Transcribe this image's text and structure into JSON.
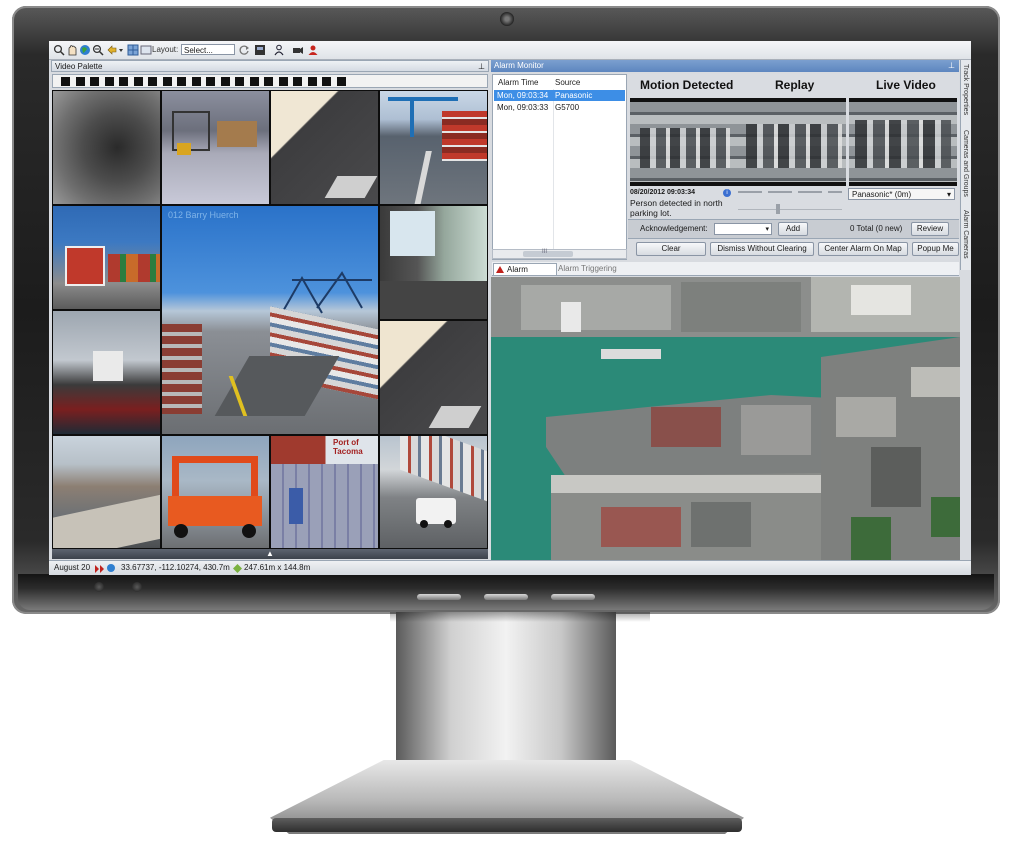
{
  "toolbar": {
    "layout_label": "Layout:",
    "layout_value": "Select...",
    "icons": [
      "zoom-icon",
      "pan-icon",
      "globe-icon",
      "zoom-out-icon",
      "navigate-icon",
      "grid-icon",
      "window-icon",
      "refresh-icon",
      "export-icon",
      "person-icon",
      "camera-icon",
      "alert-person-icon"
    ]
  },
  "video_palette": {
    "title": "Video Palette",
    "pin": "⊥"
  },
  "alarm_monitor": {
    "title": "Alarm Monitor",
    "pin": "⊥",
    "columns": [
      "Alarm Time",
      "Source"
    ],
    "rows": [
      {
        "time": "Mon, 09:03:34",
        "source": "Panasonic",
        "selected": true
      },
      {
        "time": "Mon, 09:03:33",
        "source": "G5700",
        "selected": false
      }
    ],
    "scroll_grip": "III"
  },
  "detail": {
    "motion_title": "Motion Detected",
    "replay_title": "Replay",
    "live_title": "Live Video",
    "date": "08/20/2012 09:03:34",
    "description": "Person detected in north parking lot.",
    "info_glyph": "i",
    "camera_value": "Panasonic* (0m)",
    "ack_label": "Acknowledgement:",
    "add_label": "Add",
    "total_text": "0 Total (0 new)",
    "review_label": "Review",
    "clear_label": "Clear",
    "dismiss_label": "Dismiss Without Clearing",
    "center_label": "Center Alarm On Map",
    "popup_label": "Popup Me"
  },
  "tabs": {
    "alarm_monitor": "Alarm Monitor",
    "alarm_triggering": "Alarm Triggering"
  },
  "side_tabs": [
    "Track Properties",
    "Cameras and Groups",
    "Alarm Cameras"
  ],
  "statusbar": {
    "date": "August 20",
    "coords": "33.67737, -112.10274, 430.7m",
    "size": "247.61m x 144.8m"
  },
  "grid_overlay_text": {
    "watermark": "012 Barry Huerch",
    "sign": "Port of Tacoma"
  },
  "colors": {
    "accent": "#5d86bf",
    "selected_row": "#3d8ee6",
    "water": "#2b8a78"
  }
}
